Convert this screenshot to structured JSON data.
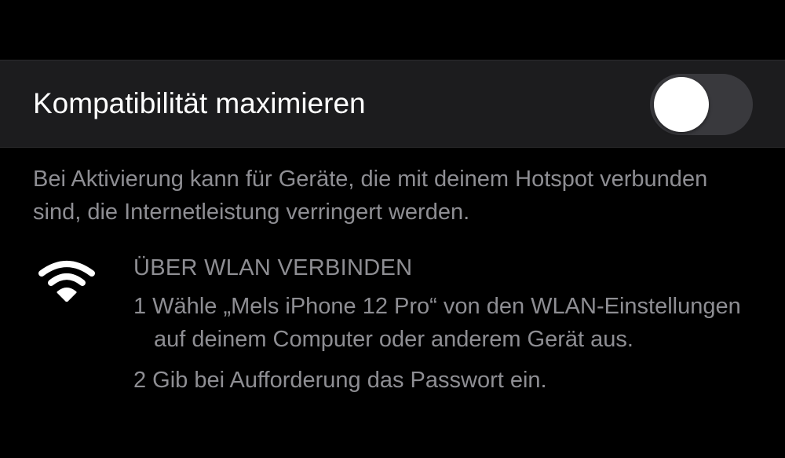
{
  "setting": {
    "label": "Kompatibilität maximieren",
    "toggle_state": "off"
  },
  "footer": {
    "text": "Bei Aktivierung kann für Geräte, die mit deinem Hotspot verbunden sind, die Internetleistung verringert werden."
  },
  "wlan_section": {
    "icon": "wifi-icon",
    "title": "ÜBER WLAN VERBINDEN",
    "steps": [
      "1 Wähle „Mels iPhone 12 Pro“ von den WLAN-Einstellungen auf deinem Computer oder anderem Gerät aus.",
      "2 Gib bei Aufforderung das Passwort ein."
    ]
  },
  "colors": {
    "background": "#000000",
    "row_background": "#1c1c1e",
    "secondary_text": "#8e8e93",
    "toggle_off_track": "#39393d",
    "knob": "#ffffff"
  }
}
